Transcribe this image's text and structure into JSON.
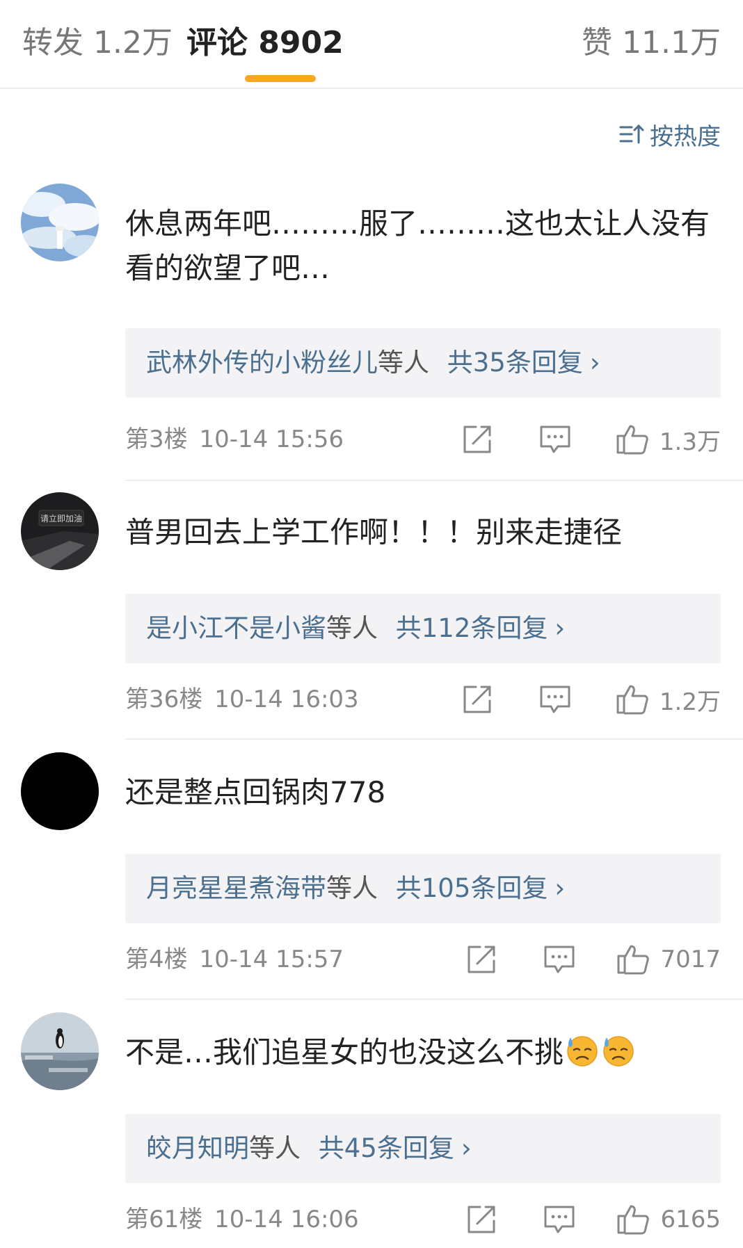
{
  "tabs": {
    "repost": "转发 1.2万",
    "comments": "评论 8902",
    "likes": "赞 11.1万",
    "active": "comments",
    "indicator_color": "#f5a623"
  },
  "sort": {
    "icon": "sort-icon",
    "label": "按热度"
  },
  "colors": {
    "link": "#4b6f8f",
    "meta": "#888888",
    "reply_bg": "#f3f3f5"
  },
  "comments": [
    {
      "avatar": "sky-clouds-avatar",
      "text": "休息两年吧………服了………这也太让人没有看的欲望了吧…",
      "reply_users": "武林外传的小粉丝儿",
      "reply_mid": "等人",
      "reply_count": "共35条回复",
      "floor": "第3楼",
      "time": "10-14 15:56",
      "likes": "1.3万"
    },
    {
      "avatar": "dark-car-avatar",
      "avatar_text": "请立即加油",
      "text": "普男回去上学工作啊！！！别来走捷径",
      "reply_users": "是小江不是小酱",
      "reply_mid": "等人",
      "reply_count": "共112条回复",
      "floor": "第36楼",
      "time": "10-14 16:03",
      "likes": "1.2万"
    },
    {
      "avatar": "black-avatar",
      "text": "还是整点回锅肉778",
      "reply_users": "月亮星星煮海带",
      "reply_mid": "等人",
      "reply_count": "共105条回复",
      "floor": "第4楼",
      "time": "10-14 15:57",
      "likes": "7017"
    },
    {
      "avatar": "penguin-sea-avatar",
      "text": "不是…我们追星女的也没这么不挑",
      "emoji": "sweat-face-emoji",
      "reply_users": "皎月知明",
      "reply_mid": "等人",
      "reply_count": "共45条回复",
      "floor": "第61楼",
      "time": "10-14 16:06",
      "likes": "6165"
    }
  ],
  "chevron": "›"
}
